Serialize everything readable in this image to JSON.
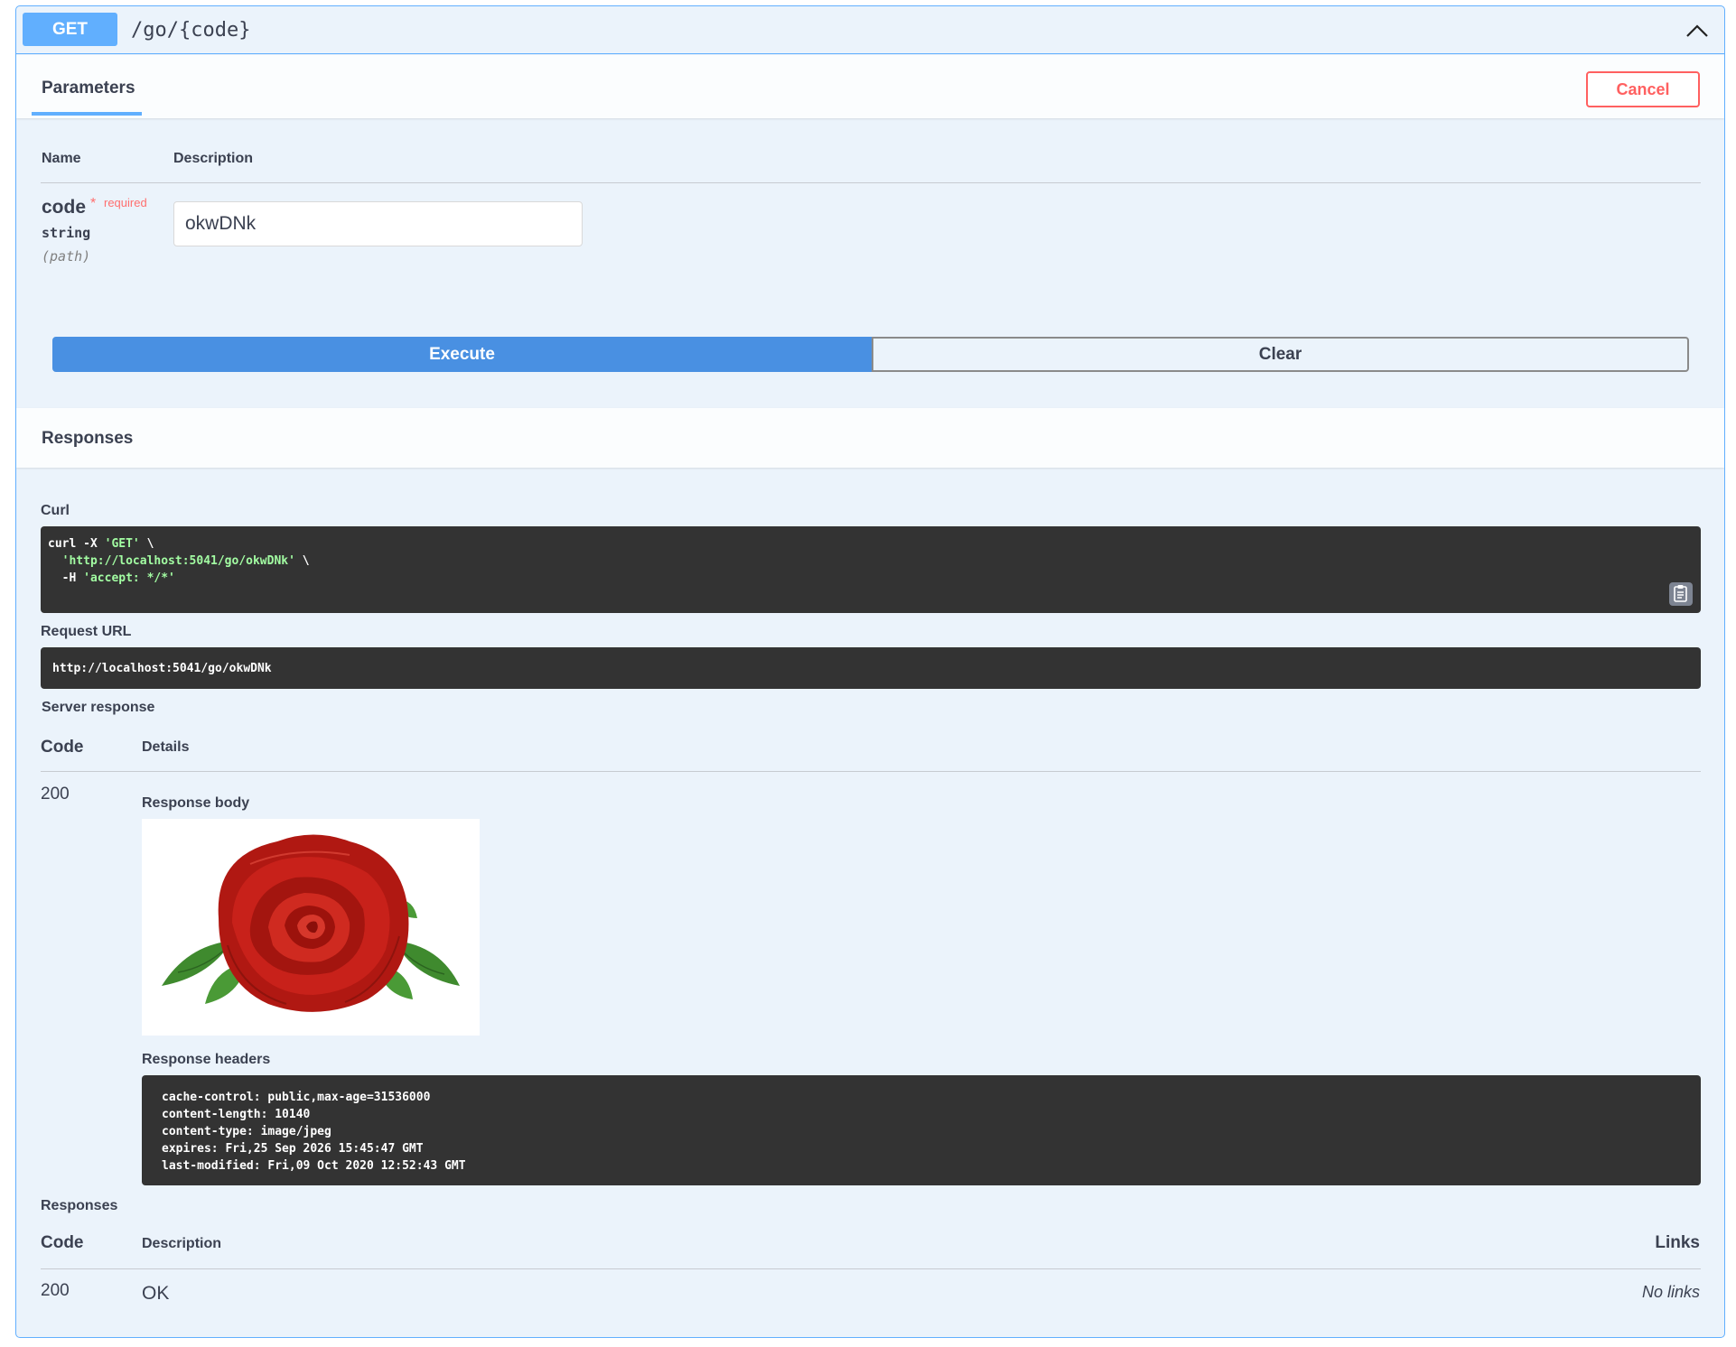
{
  "operation": {
    "method": "GET",
    "path": "/go/{code}",
    "collapse_icon": "chevron-up-icon",
    "method_color": "#61affe"
  },
  "parameters": {
    "tab_label": "Parameters",
    "cancel_label": "Cancel",
    "col_name": "Name",
    "col_description": "Description",
    "items": [
      {
        "name": "code",
        "required_star": "*",
        "required_label": "required",
        "type": "string",
        "in": "(path)",
        "value": "okwDNk"
      }
    ]
  },
  "actions": {
    "execute_label": "Execute",
    "clear_label": "Clear"
  },
  "responses_section": {
    "title": "Responses",
    "curl_label": "Curl",
    "curl": {
      "line1_a": "curl -X ",
      "line1_b": "'GET'",
      "line1_c": " \\",
      "line2_a": "  ",
      "line2_b": "'http://localhost:5041/go/okwDNk'",
      "line2_c": " \\",
      "line3_a": "  -H ",
      "line3_b": "'accept: */*'"
    },
    "copy_icon": "copy-to-clipboard-icon",
    "request_url_label": "Request URL",
    "request_url": "http://localhost:5041/go/okwDNk",
    "server_response_label": "Server response",
    "col_code": "Code",
    "col_details": "Details",
    "response": {
      "code": "200",
      "body_label": "Response body",
      "body_image": "red-rose-image",
      "headers_label": "Response headers",
      "headers": [
        "cache-control: public,max-age=31536000",
        "content-length: 10140",
        "content-type: image/jpeg",
        "expires: Fri,25 Sep 2026 15:45:47 GMT",
        "last-modified: Fri,09 Oct 2020 12:52:43 GMT"
      ]
    }
  },
  "documented_responses": {
    "title": "Responses",
    "col_code": "Code",
    "col_description": "Description",
    "col_links": "Links",
    "rows": [
      {
        "code": "200",
        "description": "OK",
        "links": "No links"
      }
    ]
  }
}
